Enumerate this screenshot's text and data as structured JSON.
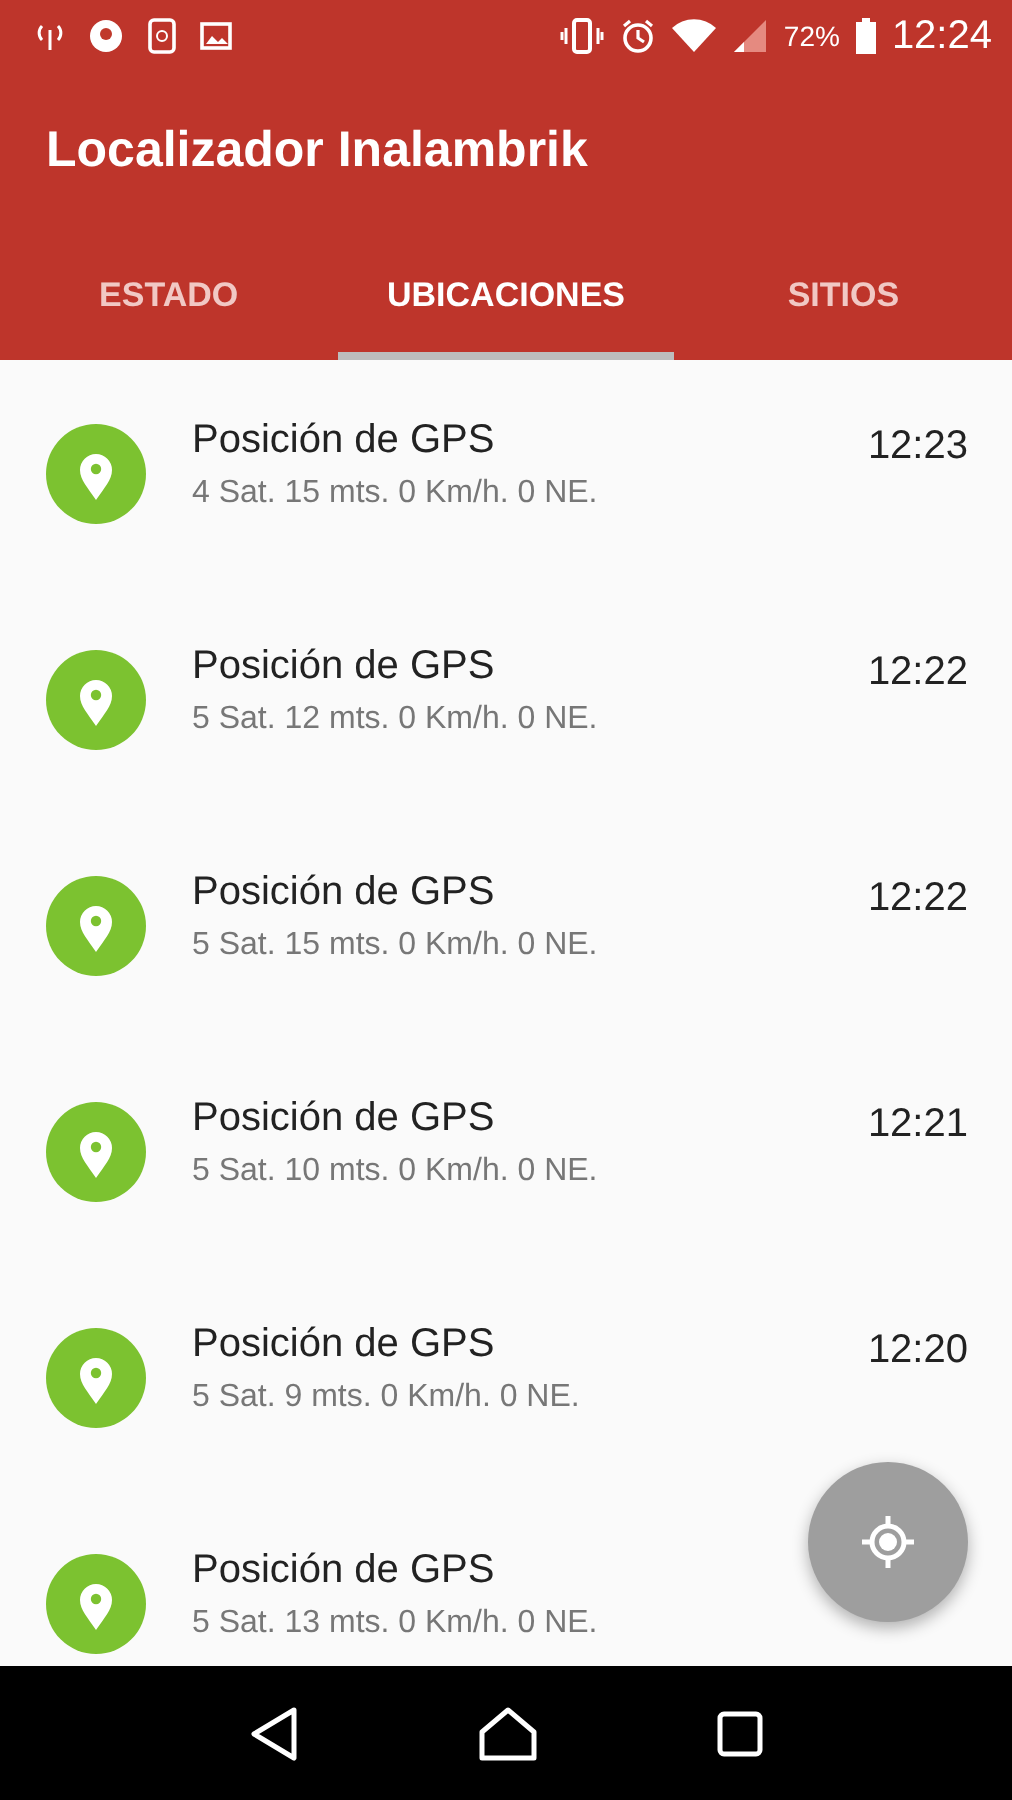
{
  "status_bar": {
    "battery": "72%",
    "time": "12:24"
  },
  "app_bar": {
    "title": "Localizador Inalambrik"
  },
  "tabs": [
    {
      "label": "ESTADO",
      "selected": false
    },
    {
      "label": "UBICACIONES",
      "selected": true
    },
    {
      "label": "SITIOS",
      "selected": false
    }
  ],
  "locations": [
    {
      "title": "Posición de GPS",
      "detail": "4 Sat. 15 mts. 0 Km/h. 0 NE.",
      "time": "12:23"
    },
    {
      "title": "Posición de GPS",
      "detail": "5 Sat. 12 mts. 0 Km/h. 0 NE.",
      "time": "12:22"
    },
    {
      "title": "Posición de GPS",
      "detail": "5 Sat. 15 mts. 0 Km/h. 0 NE.",
      "time": "12:22"
    },
    {
      "title": "Posición de GPS",
      "detail": "5 Sat. 10 mts. 0 Km/h. 0 NE.",
      "time": "12:21"
    },
    {
      "title": "Posición de GPS",
      "detail": "5 Sat. 9 mts. 0 Km/h. 0 NE.",
      "time": "12:20"
    },
    {
      "title": "Posición de GPS",
      "detail": "5 Sat. 13 mts. 0 Km/h. 0 NE."
    }
  ]
}
